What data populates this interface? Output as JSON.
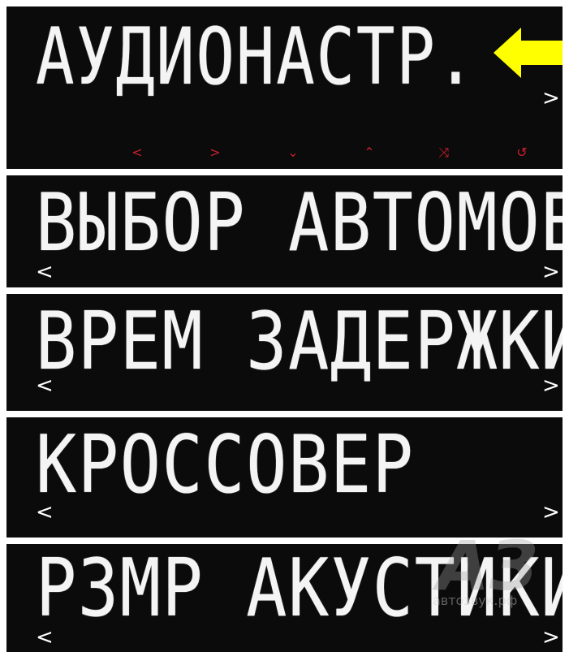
{
  "colors": {
    "panel_bg": "#0b0b0b",
    "segment_text": "#f4f4f4",
    "control_red": "#c8202a",
    "pointer_arrow": "#ffff00"
  },
  "screens": [
    {
      "text": "АУДИОНАСТР.",
      "nav_left": "",
      "nav_right": ">"
    },
    {
      "text": "ВЫБОР АВТОМОБ",
      "nav_left": "<",
      "nav_right": ">"
    },
    {
      "text": "ВРЕМ ЗАДЕРЖКИ",
      "nav_left": "<",
      "nav_right": ">"
    },
    {
      "text": "КРОССОВЕР",
      "nav_left": "<",
      "nav_right": ">"
    },
    {
      "text": "РЗМР АКУСТИКИ",
      "nav_left": "<",
      "nav_right": ">"
    }
  ],
  "controls": {
    "prev": "<",
    "next": ">",
    "down": "⌄",
    "up": "⌃",
    "shuffle": "⤨",
    "repeat": "↺"
  },
  "watermark": {
    "logo": "АЗ",
    "site": "автозвук.рф"
  }
}
